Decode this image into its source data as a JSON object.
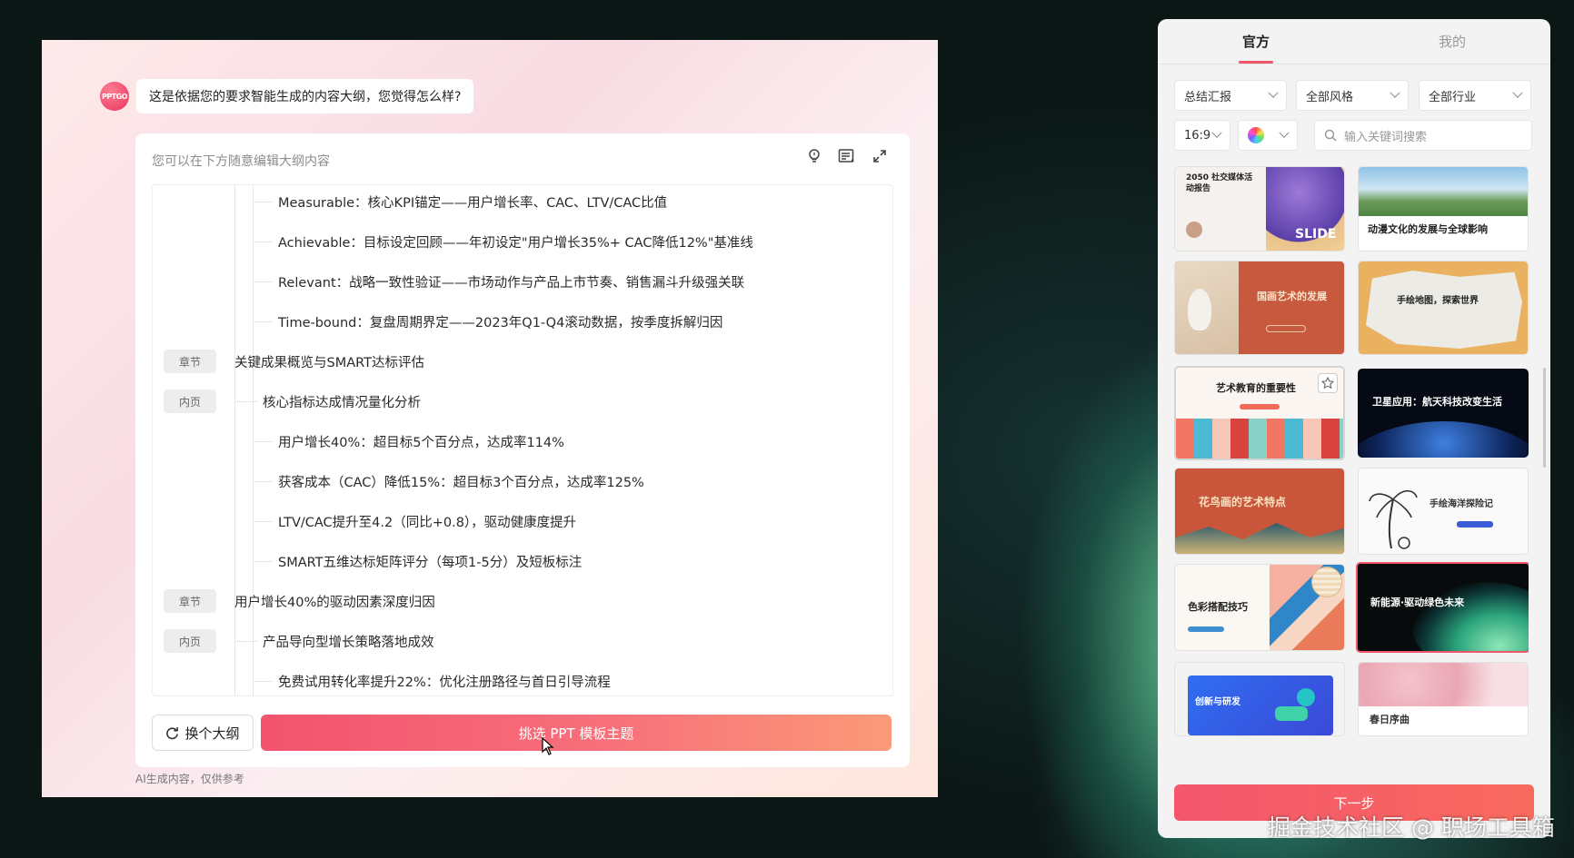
{
  "chat": {
    "avatar_text": "PPTGO",
    "bot_message": "这是依据您的要求智能生成的内容大纲，您觉得怎么样?"
  },
  "outline_editor": {
    "hint": "您可以在下方随意编辑大纲内容",
    "tool_icons": [
      "lightbulb-icon",
      "format-list-icon",
      "expand-icon"
    ],
    "lines": [
      {
        "tag": "",
        "level": 3,
        "text": "Measurable：核心KPI锚定——用户增长率、CAC、LTV/CAC比值"
      },
      {
        "tag": "",
        "level": 3,
        "text": "Achievable：目标设定回顾——年初设定\"用户增长35%+ CAC降低12%\"基准线"
      },
      {
        "tag": "",
        "level": 3,
        "text": "Relevant：战略一致性验证——市场动作与产品上市节奏、销售漏斗升级强关联"
      },
      {
        "tag": "",
        "level": 3,
        "text": "Time-bound：复盘周期界定——2023年Q1-Q4滚动数据，按季度拆解归因"
      },
      {
        "tag": "章节",
        "level": 1,
        "text": "关键成果概览与SMART达标评估"
      },
      {
        "tag": "内页",
        "level": 2,
        "text": "核心指标达成情况量化分析"
      },
      {
        "tag": "",
        "level": 3,
        "text": "用户增长40%：超目标5个百分点，达成率114%"
      },
      {
        "tag": "",
        "level": 3,
        "text": "获客成本（CAC）降低15%：超目标3个百分点，达成率125%"
      },
      {
        "tag": "",
        "level": 3,
        "text": "LTV/CAC提升至4.2（同比+0.8），驱动健康度提升"
      },
      {
        "tag": "",
        "level": 3,
        "text": "SMART五维达标矩阵评分（每项1-5分）及短板标注"
      },
      {
        "tag": "章节",
        "level": 1,
        "text": "用户增长40%的驱动因素深度归因"
      },
      {
        "tag": "内页",
        "level": 2,
        "text": "产品导向型增长策略落地成效"
      },
      {
        "tag": "",
        "level": 3,
        "text": "免费试用转化率提升22%：优化注册路径与首日引导流程"
      }
    ],
    "swap_button": "换个大纲",
    "pick_button": "挑选 PPT 模板主题",
    "ai_note": "AI生成内容，仅供参考"
  },
  "template_panel": {
    "tabs": [
      "官方",
      "我的"
    ],
    "active_tab": "官方",
    "filters": {
      "category": "总结汇报",
      "style": "全部风格",
      "industry": "全部行业",
      "ratio": "16:9",
      "search_placeholder": "输入关键词搜索"
    },
    "templates": [
      {
        "title": "2050 社交媒体活动报告",
        "extra": "SLIDE"
      },
      {
        "title": "动漫文化的发展与全球影响",
        "extra": ""
      },
      {
        "title": "国画艺术的发展",
        "extra": ""
      },
      {
        "title": "手绘地图，探索世界",
        "extra": ""
      },
      {
        "title": "艺术教育的重要性",
        "extra": ""
      },
      {
        "title": "卫星应用：航天科技改变生活",
        "extra": ""
      },
      {
        "title": "花鸟画的艺术特点",
        "extra": ""
      },
      {
        "title": "手绘海洋探险记",
        "extra": ""
      },
      {
        "title": "色彩搭配技巧",
        "extra": ""
      },
      {
        "title": "新能源·驱动绿色未来",
        "extra": ""
      },
      {
        "title": "创新与研发",
        "extra": ""
      },
      {
        "title": "春日序曲",
        "extra": ""
      }
    ],
    "selected_template": "新能源·驱动绿色未来",
    "hovered_template": "艺术教育的重要性",
    "next_button": "下一步"
  },
  "watermark": "掘金技术社区 @ 职场工具箱",
  "colors": {
    "accent": "#f0566a",
    "button_gradient_start": "#f2536f",
    "button_gradient_end": "#fb9a78"
  }
}
